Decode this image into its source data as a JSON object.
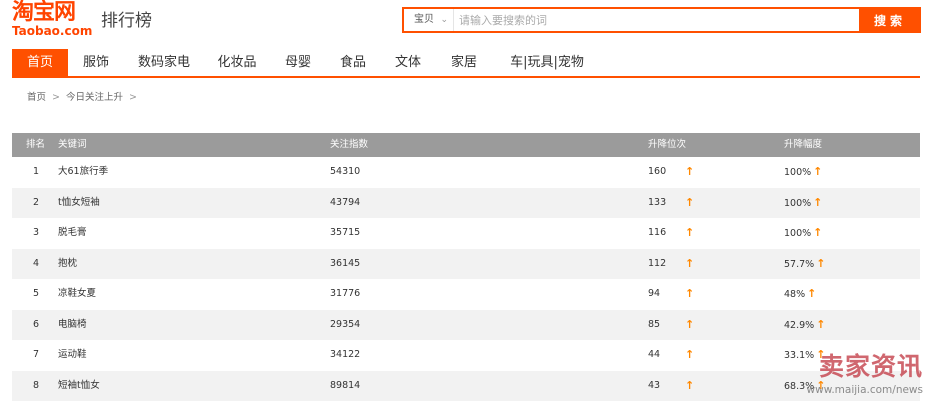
{
  "header": {
    "logo_cn": "淘宝网",
    "logo_en": "Taobao.com",
    "title": "排行榜"
  },
  "search": {
    "scope": "宝贝",
    "placeholder": "请输入要搜索的词",
    "button": "搜索"
  },
  "nav": {
    "items": [
      "首页",
      "服饰",
      "数码家电",
      "化妆品",
      "母婴",
      "食品",
      "文体",
      "家居",
      "车|玩具|宠物"
    ],
    "active_index": 0
  },
  "breadcrumb": {
    "items": [
      "首页",
      "今日关注上升"
    ]
  },
  "table": {
    "columns": [
      "排名",
      "关键词",
      "关注指数",
      "升降位次",
      "升降幅度"
    ],
    "rows": [
      {
        "rank": "1",
        "keyword": "大61旅行季",
        "index": "54310",
        "position": "160",
        "percent": "100%"
      },
      {
        "rank": "2",
        "keyword": "t恤女短袖",
        "index": "43794",
        "position": "133",
        "percent": "100%"
      },
      {
        "rank": "3",
        "keyword": "脱毛膏",
        "index": "35715",
        "position": "116",
        "percent": "100%"
      },
      {
        "rank": "4",
        "keyword": "抱枕",
        "index": "36145",
        "position": "112",
        "percent": "57.7%"
      },
      {
        "rank": "5",
        "keyword": "凉鞋女夏",
        "index": "31776",
        "position": "94",
        "percent": "48%"
      },
      {
        "rank": "6",
        "keyword": "电脑椅",
        "index": "29354",
        "position": "85",
        "percent": "42.9%"
      },
      {
        "rank": "7",
        "keyword": "运动鞋",
        "index": "34122",
        "position": "44",
        "percent": "33.1%"
      },
      {
        "rank": "8",
        "keyword": "短袖t恤女",
        "index": "89814",
        "position": "43",
        "percent": "68.3%"
      }
    ],
    "trend_icon": "up-arrow-icon",
    "trend_symbol": "↑"
  },
  "watermark": {
    "cn": "卖家资讯",
    "url": "www.maijia.com/news"
  },
  "colors": {
    "brand": "#ff5000",
    "header_row": "#9b9b9b",
    "alt_row": "#f2f2f2",
    "arrow": "#ff8800"
  }
}
